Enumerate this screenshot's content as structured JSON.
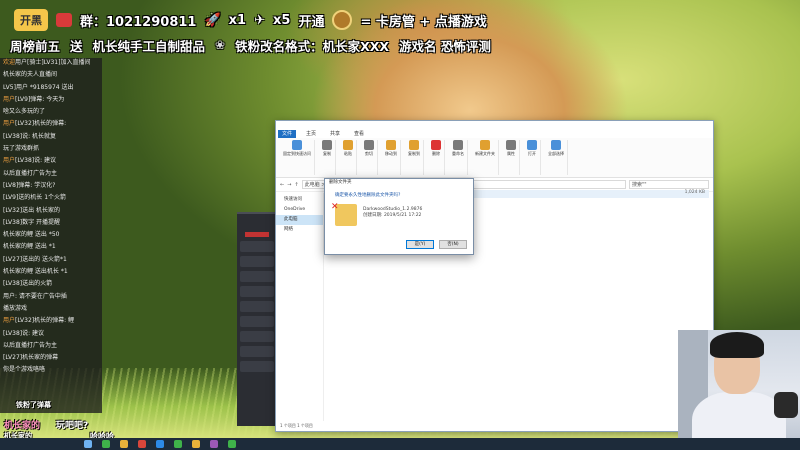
{
  "overlay": {
    "top_line": {
      "logo_text": "开黑",
      "group_text": "群：1021290811",
      "count_1": "x1",
      "count_2": "x5",
      "open_text": "开通",
      "benefit_text": "= 卡房管 + 点播游戏"
    },
    "second_line": {
      "text_1": "周榜前五",
      "text_2": "送",
      "text_3": "机长纯手工自制甜品",
      "flower": "❀",
      "text_4": "铁粉改名格式：机长家XXX",
      "text_5": "游戏名 恐怖评测"
    }
  },
  "chat": {
    "messages": [
      {
        "nick": "欢迎",
        "text": "用户[骑士]LV31]加入直播间"
      },
      {
        "nick": "",
        "text": "机长家的夫人直播间"
      },
      {
        "nick": "",
        "text": "LV5]用户 *9185974 送出"
      },
      {
        "nick": "用户",
        "text": "[LV9]弹幕: 今天为"
      },
      {
        "nick": "",
        "text": "啥又么多玩的了"
      },
      {
        "nick": "用户",
        "text": "[LV32]机长的弹幕:"
      },
      {
        "nick": "",
        "text": "[LV38]说: 机长就复"
      },
      {
        "nick": "",
        "text": "玩了游戏群抓"
      },
      {
        "nick": "用户",
        "text": "[LV38]说: 建议"
      },
      {
        "nick": "",
        "text": "以后直播打广告为主"
      },
      {
        "nick": "",
        "text": "[LV8]弹幕: 学汉化?"
      },
      {
        "nick": "",
        "text": "[LV9]送的机长 1个火箭"
      },
      {
        "nick": "",
        "text": "[LV32]送出 机长家的"
      },
      {
        "nick": "",
        "text": "[LV38]数字 开播提醒"
      },
      {
        "nick": "",
        "text": "机长家的鲤 送出 *50"
      },
      {
        "nick": "",
        "text": "机长家的鲤 送出 *1"
      },
      {
        "nick": "",
        "text": "[LV27]送出的 送火箭*1"
      },
      {
        "nick": "",
        "text": "机长家的鲤 送出机长 *1"
      },
      {
        "nick": "",
        "text": "[LV38]送出的火箭"
      },
      {
        "nick": "",
        "text": "用户: 请不要在广告中插"
      },
      {
        "nick": "",
        "text": "播放游戏"
      },
      {
        "nick": "用户",
        "text": "[LV32]机长的弹幕: 鲤"
      },
      {
        "nick": "",
        "text": "[LV38]说: 建议"
      },
      {
        "nick": "",
        "text": "以后直播打广告为主"
      },
      {
        "nick": "",
        "text": "[LV27]机长家的弹幕"
      },
      {
        "nick": "",
        "text": "你是个游戏咯咯"
      }
    ]
  },
  "explorer": {
    "tabs": [
      "文件",
      "主页",
      "共享",
      "查看"
    ],
    "ribbon_groups": [
      "固定到快速访问",
      "复制",
      "粘贴",
      "剪切",
      "移动到",
      "复制到",
      "删除",
      "重命名",
      "新建文件夹",
      "属性",
      "打开",
      "全部选择"
    ],
    "address_path": "此电脑 > 本地磁盘 (D:) > ...",
    "search_placeholder": "搜索\"\"",
    "nav_items": [
      "快速访问",
      "OneDrive",
      "此电脑",
      "网络"
    ],
    "file_row": {
      "name": "",
      "size": "1,024 KB"
    },
    "status": "1 个项目  1 个项目"
  },
  "dialog": {
    "title": "删除文件夹",
    "message": "确定要永久性地删除此文件夹吗?",
    "file_name": "DarkwoodStudio_1.2.9876",
    "file_date": "创建日期: 2019/5/21 17:22",
    "confirm_label": "是(Y)",
    "cancel_label": "否(N)"
  },
  "ticker": {
    "line_1": "铁粉了弹幕",
    "line_2": "机长家的",
    "line_3": "玩吧吧?",
    "line_4": "机长家的",
    "line_5": "哈哈哈"
  },
  "colors": {
    "accent": "#1f6fc4",
    "chat_bg": "#1e1e1e",
    "overlay_text": "#ffffff"
  }
}
